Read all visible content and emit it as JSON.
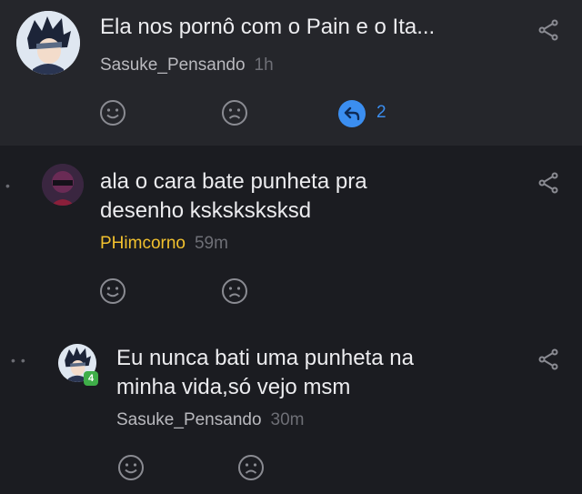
{
  "comments": [
    {
      "text": "Ela nos pornô com o Pain e o Ita...",
      "author": "Sasuke_Pensando",
      "time": "1h",
      "reply_count": "2"
    },
    {
      "text": "ala o cara bate punheta pra\ndesenho ksksksksksd",
      "author": "PHimcorno",
      "time": "59m",
      "author_color": "#f2c12e"
    },
    {
      "text": "Eu nunca bati uma punheta na\nminha vida,só vejo msm",
      "author": "Sasuke_Pensando",
      "time": "30m",
      "level": "4"
    }
  ],
  "icons": {
    "share": "share-icon",
    "like": "smile-icon",
    "dislike": "sad-icon",
    "reply": "reply-icon"
  },
  "colors": {
    "background": "#1b1c21",
    "header_bg": "#25262b",
    "accent": "#3b8ef0",
    "author_highlight": "#f2c12e"
  }
}
